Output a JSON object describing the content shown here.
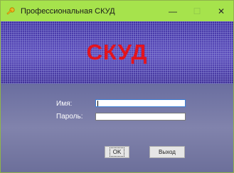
{
  "window": {
    "title": "Профессиональная СКУД",
    "controls": {
      "minimize": "—",
      "maximize": "☐",
      "close": "✕"
    }
  },
  "banner": {
    "title": "СКУД",
    "title_color": "#e3141e"
  },
  "form": {
    "name_label": "Имя:",
    "name_value": "",
    "password_label": "Пароль:",
    "password_value": ""
  },
  "buttons": {
    "ok": "OK",
    "exit": "Выход"
  },
  "colors": {
    "titlebar": "#a6e34c",
    "banner_bg": "#4e3fa8",
    "body_bg": "#7577a6"
  },
  "icons": {
    "app": "key-icon"
  }
}
